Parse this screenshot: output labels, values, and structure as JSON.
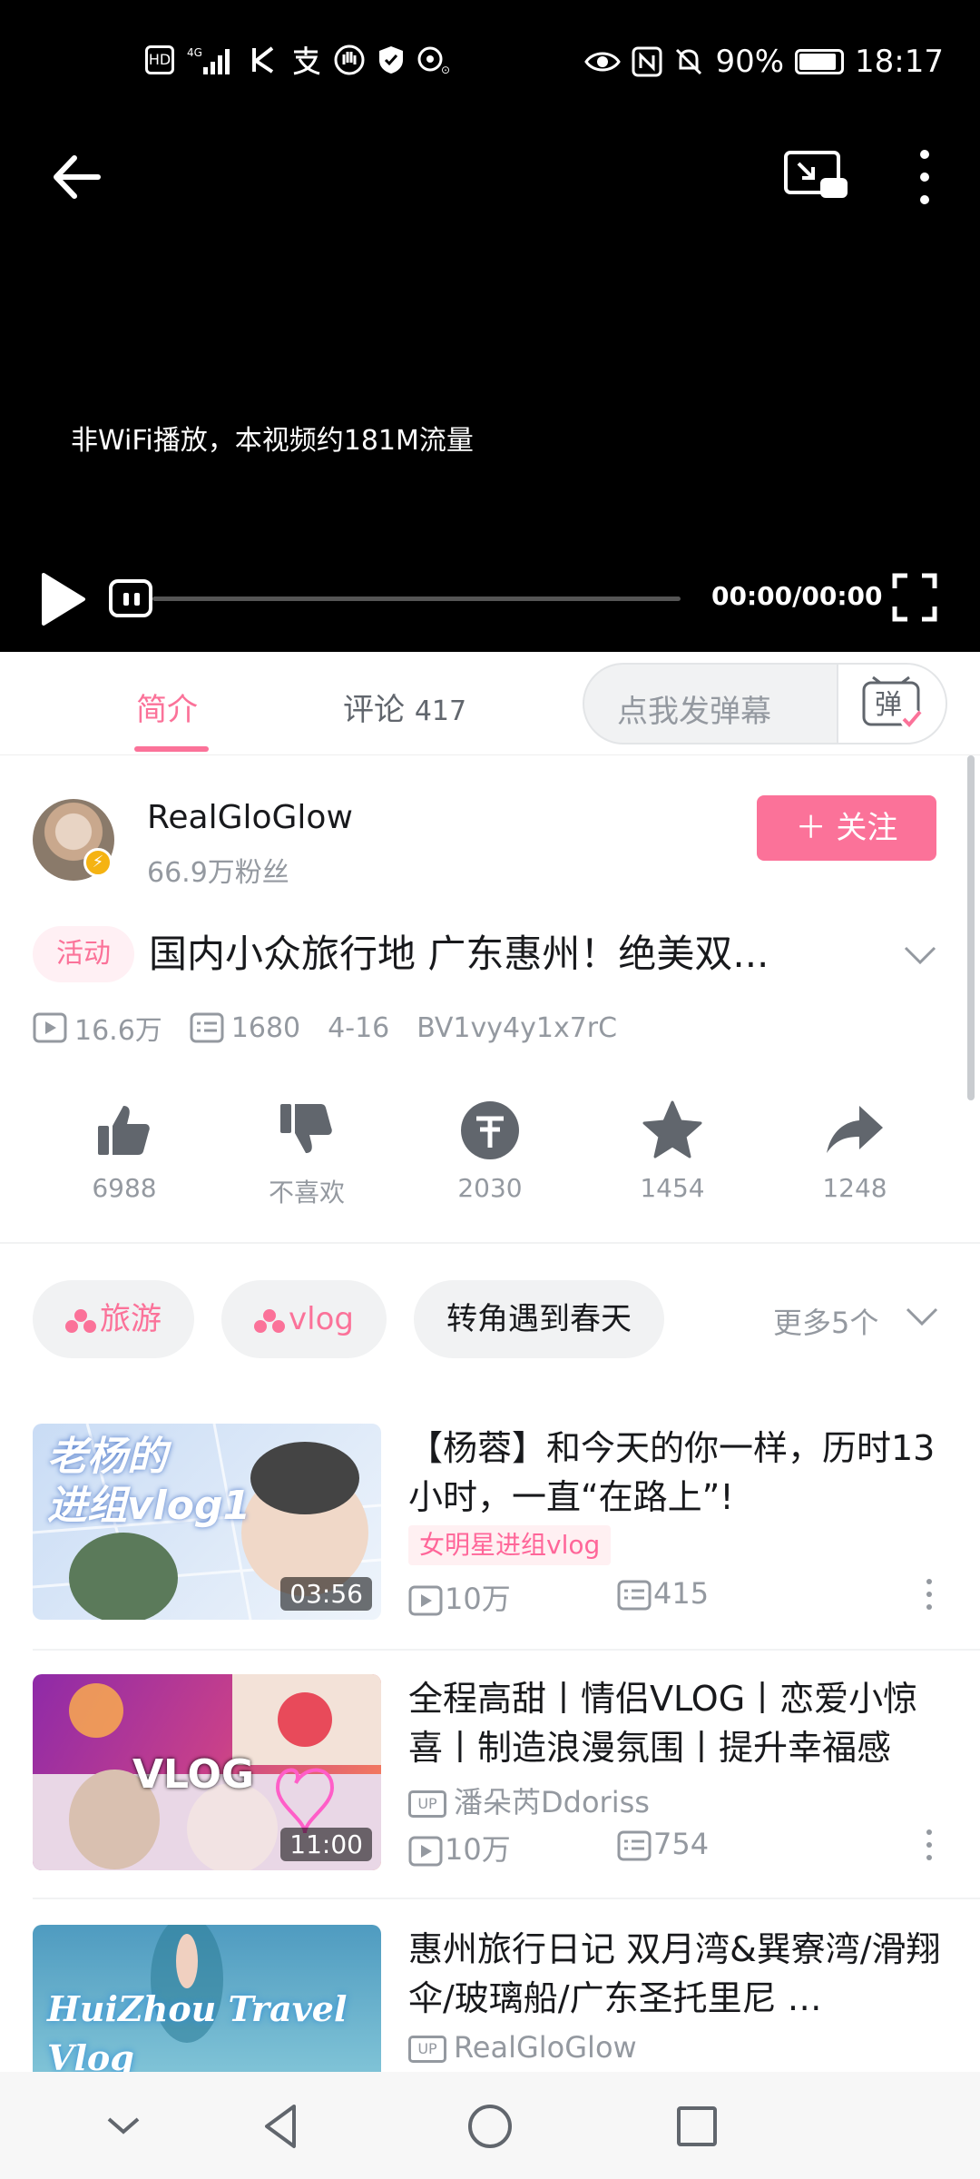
{
  "status_bar": {
    "left_icons": [
      "hd-icon",
      "signal-4g-icon",
      "k-app-icon",
      "alipay-icon",
      "hand-icon",
      "shield-icon",
      "wifi-hotspot-icon"
    ],
    "battery": "90%",
    "time": "18:17"
  },
  "player": {
    "data_notice": "非WiFi播放，本视频约181M流量",
    "timecode": "00:00/00:00"
  },
  "tabs": {
    "intro": "简介",
    "comments_label": "评论",
    "comments_count": "417",
    "danmaku_placeholder": "点我发弹幕",
    "danmaku_toggle": "弹"
  },
  "uploader": {
    "name": "RealGloGlow",
    "fans": "66.9万粉丝",
    "follow_label": "＋ 关注"
  },
  "video": {
    "activity_tag": "活动",
    "title": "国内小众旅行地 广东惠州！绝美双...",
    "views": "16.6万",
    "danmaku_count": "1680",
    "date": "4-16",
    "bvid": "BV1vy4y1x7rC"
  },
  "actions": [
    {
      "name": "like",
      "label": "6988"
    },
    {
      "name": "dislike",
      "label": "不喜欢"
    },
    {
      "name": "coin",
      "label": "2030"
    },
    {
      "name": "favorite",
      "label": "1454"
    },
    {
      "name": "share",
      "label": "1248"
    }
  ],
  "tags": [
    {
      "label": "旅游",
      "pink": true
    },
    {
      "label": "vlog",
      "pink": true
    },
    {
      "label": "转角遇到春天",
      "pink": false
    }
  ],
  "more_tags": "更多5个",
  "related": [
    {
      "thumb_text": "老杨的\n进组vlog1",
      "duration": "03:56",
      "title": "【杨蓉】和今天的你一样，历时13小时，一直“在路上”!",
      "badge": "女明星进组vlog",
      "views": "10万",
      "danmaku": "415",
      "colors": [
        "#b9d3f2",
        "#e9f1fb"
      ]
    },
    {
      "thumb_text": "VLOG",
      "duration": "11:00",
      "title": "全程高甜丨情侣VLOG丨恋爱小惊喜丨制造浪漫氛围丨提升幸福感",
      "up": "潘朵芮Ddoriss",
      "views": "10万",
      "danmaku": "754",
      "colors": [
        "#9b2fb5",
        "#ff7a4a"
      ]
    },
    {
      "thumb_text": "HuiZhou Travel Vlog",
      "title": "惠州旅行日记 双月湾&巽寮湾/滑翔伞/玻璃船/广东圣托里尼 …",
      "up": "RealGloGlow",
      "colors": [
        "#5fa9c9",
        "#8fd0de"
      ]
    }
  ],
  "accent_color": "#fb7299"
}
